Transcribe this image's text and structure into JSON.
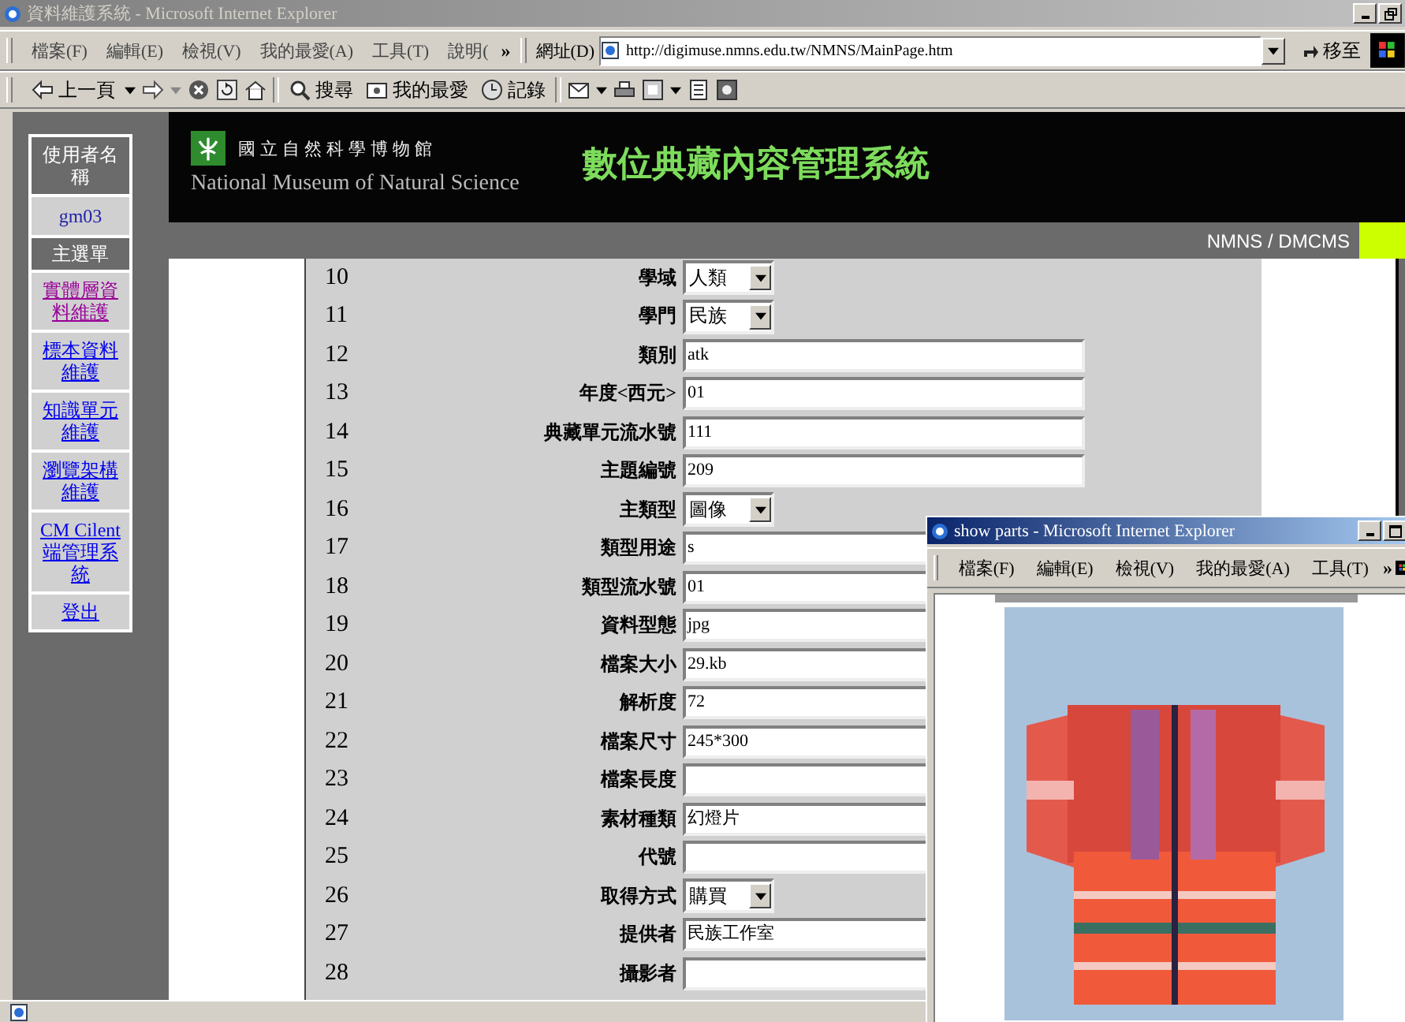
{
  "window": {
    "title": "資料維護系統 - Microsoft Internet Explorer"
  },
  "menu_bar": [
    "檔案(F)",
    "編輯(E)",
    "檢視(V)",
    "我的最愛(A)",
    "工具(T)",
    "說明("
  ],
  "menu_overflow": "»",
  "address_bar": {
    "label": "網址(D)",
    "url": "http://digimuse.nmns.edu.tw/NMNS/MainPage.htm",
    "go_button": "移至"
  },
  "toolbar": {
    "back": "上一頁",
    "search": "搜尋",
    "favorites": "我的最愛",
    "history": "記錄"
  },
  "sidebar": {
    "user_label": "使用者名稱",
    "user": "gm03",
    "menu_title": "主選單",
    "links": [
      {
        "label": "實體層資料維護",
        "visited": true
      },
      {
        "label": "標本資料維護",
        "visited": false
      },
      {
        "label": "知識單元維護",
        "visited": false
      },
      {
        "label": "瀏覽架構維護",
        "visited": false
      },
      {
        "label": "CM Cilent端管理系統",
        "visited": false
      },
      {
        "label": "登出",
        "visited": false
      }
    ]
  },
  "banner": {
    "museum_name_zh": "國立自然科學博物館",
    "museum_name_en": "National Museum of Natural Science",
    "system_title": "數位典藏內容管理系統"
  },
  "breadcrumb": "NMNS / DMCMS",
  "form": {
    "rows": [
      {
        "number": "10",
        "label": "學域",
        "kind": "select",
        "value": "人類"
      },
      {
        "number": "11",
        "label": "學門",
        "kind": "select",
        "value": "民族"
      },
      {
        "number": "12",
        "label": "類別",
        "kind": "text",
        "value": "atk"
      },
      {
        "number": "13",
        "label": "年度<西元>",
        "kind": "text",
        "value": "01"
      },
      {
        "number": "14",
        "label": "典藏單元流水號",
        "kind": "text",
        "value": "111"
      },
      {
        "number": "15",
        "label": "主題編號",
        "kind": "text",
        "value": "209"
      },
      {
        "number": "16",
        "label": "主類型",
        "kind": "select",
        "value": "圖像"
      },
      {
        "number": "17",
        "label": "類型用途",
        "kind": "text",
        "value": "s"
      },
      {
        "number": "18",
        "label": "類型流水號",
        "kind": "text",
        "value": "01"
      },
      {
        "number": "19",
        "label": "資料型態",
        "kind": "text",
        "value": "jpg"
      },
      {
        "number": "20",
        "label": "檔案大小",
        "kind": "text",
        "value": "29.kb"
      },
      {
        "number": "21",
        "label": "解析度",
        "kind": "text",
        "value": "72"
      },
      {
        "number": "22",
        "label": "檔案尺寸",
        "kind": "text",
        "value": "245*300"
      },
      {
        "number": "23",
        "label": "檔案長度",
        "kind": "text"
      },
      {
        "number": "24",
        "label": "素材種類",
        "kind": "text",
        "value": "幻燈片"
      },
      {
        "number": "25",
        "label": "代號",
        "kind": "text"
      },
      {
        "number": "26",
        "label": "取得方式",
        "kind": "select",
        "value": "購買"
      },
      {
        "number": "27",
        "label": "提供者",
        "kind": "text",
        "value": "民族工作室"
      },
      {
        "number": "28",
        "label": "攝影者",
        "kind": "text"
      }
    ]
  },
  "popup": {
    "title": "show parts - Microsoft Internet Explorer",
    "menu_bar": [
      "檔案(F)",
      "編輯(E)",
      "檢視(V)",
      "我的最愛(A)",
      "工具(T)"
    ],
    "menu_overflow": "»"
  }
}
